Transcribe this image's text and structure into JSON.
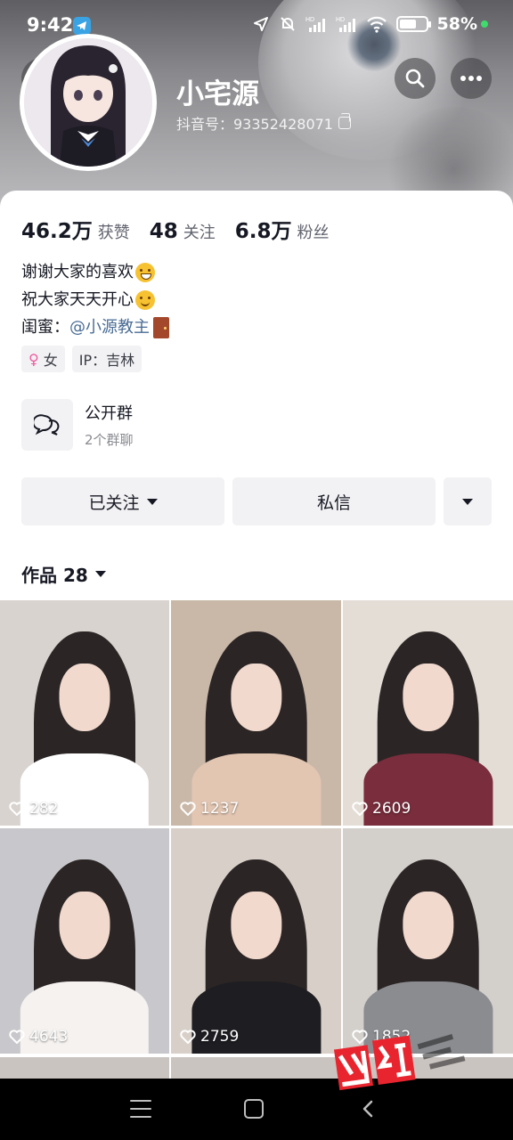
{
  "status_bar": {
    "time": "9:42",
    "battery_percent": "58%",
    "battery_level": 0.58,
    "icons": [
      "telegram-icon",
      "location-icon",
      "mute-icon",
      "signal-hd-icon",
      "signal-hd-icon",
      "wifi-icon",
      "battery-icon"
    ]
  },
  "profile": {
    "name": "小宅源",
    "douyin_id": "抖音号：93352428071"
  },
  "stats": [
    {
      "value": "46.2万",
      "label": "获赞"
    },
    {
      "value": "48",
      "label": "关注"
    },
    {
      "value": "6.8万",
      "label": "粉丝"
    }
  ],
  "bio": {
    "line1": "谢谢大家的喜欢",
    "line2": "祝大家天天开心",
    "line3_prefix": "闺蜜：",
    "line3_mention": "@小源教主"
  },
  "tags": {
    "gender": "女",
    "ip": "IP：吉林"
  },
  "group": {
    "title": "公开群",
    "subtitle": "2个群聊"
  },
  "actions": {
    "follow": "已关注",
    "message": "私信"
  },
  "works": {
    "label": "作品 28"
  },
  "videos": [
    {
      "likes": "282",
      "bg": "#d9d3cf",
      "body": "#ffffff"
    },
    {
      "likes": "1237",
      "bg": "#c9b8a8",
      "body": "#e2c6b2"
    },
    {
      "likes": "2609",
      "bg": "#e4ddd6",
      "body": "#7a2d3c"
    },
    {
      "likes": "4643",
      "bg": "#c8c8cc",
      "body": "#f5f2f0"
    },
    {
      "likes": "2759",
      "bg": "#d8d0c8",
      "body": "#1d1d22"
    },
    {
      "likes": "1852",
      "bg": "#d3cfcb",
      "body": "#8b8c90"
    }
  ],
  "colors": {
    "accent_mention": "#4a6c94",
    "button_bg": "#f2f2f4",
    "text_primary": "#161823"
  }
}
